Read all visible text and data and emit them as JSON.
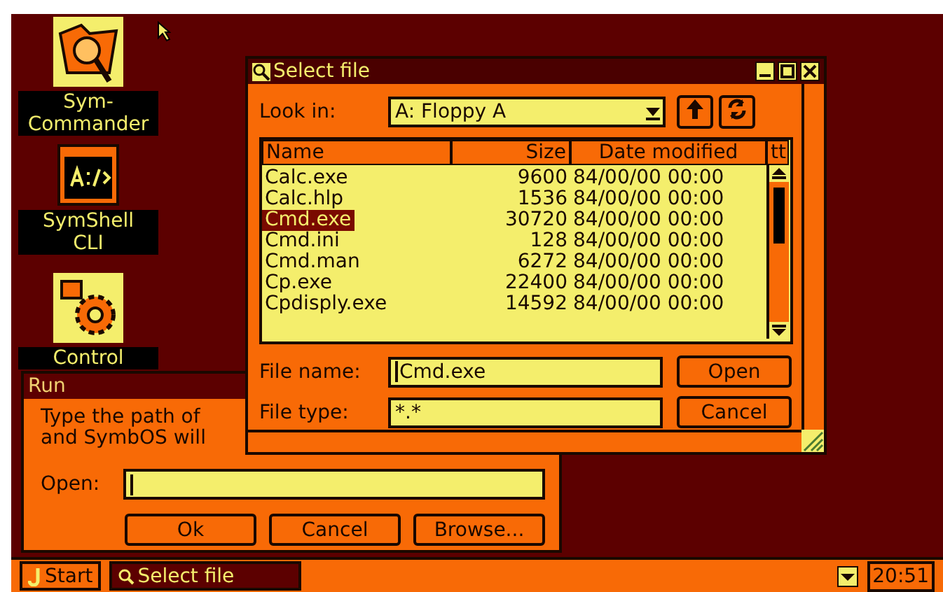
{
  "desktop_icons": [
    {
      "kind": "commander",
      "lines": [
        "Sym-",
        "Commander"
      ]
    },
    {
      "kind": "shell",
      "lines": [
        "SymShell",
        "CLI"
      ]
    },
    {
      "kind": "control",
      "lines": [
        "Control"
      ]
    }
  ],
  "run_window": {
    "title": "Run",
    "active": false,
    "message_lines": [
      "Type the path of",
      "and SymbOS will"
    ],
    "open_label": "Open:",
    "buttons": [
      "Ok",
      "Cancel",
      "Browse..."
    ]
  },
  "file_dialog": {
    "title": "Select file",
    "active": true,
    "look_in_label": "Look in:",
    "look_in_value": "A: Floppy A",
    "columns": [
      {
        "label": "Name"
      },
      {
        "label": "Size"
      },
      {
        "label": "Date modified"
      },
      {
        "label": "tt"
      }
    ],
    "rows": [
      {
        "name": "Calc.exe",
        "size": "9600",
        "date": "84/00/00 00:00",
        "selected": false
      },
      {
        "name": "Calc.hlp",
        "size": "1536",
        "date": "84/00/00 00:00",
        "selected": false
      },
      {
        "name": "Cmd.exe",
        "size": "30720",
        "date": "84/00/00 00:00",
        "selected": true
      },
      {
        "name": "Cmd.ini",
        "size": "128",
        "date": "84/00/00 00:00",
        "selected": false
      },
      {
        "name": "Cmd.man",
        "size": "6272",
        "date": "84/00/00 00:00",
        "selected": false
      },
      {
        "name": "Cp.exe",
        "size": "22400",
        "date": "84/00/00 00:00",
        "selected": false
      },
      {
        "name": "Cpdisply.exe",
        "size": "14592",
        "date": "84/00/00 00:00",
        "selected": false
      }
    ],
    "file_name_label": "File name:",
    "file_name_value": "Cmd.exe",
    "file_type_label": "File type:",
    "file_type_value": "*.*",
    "buttons": [
      "Open",
      "Cancel"
    ]
  },
  "taskbar": {
    "start": "Start",
    "tasks": [
      {
        "label": "Select file",
        "selected": true
      }
    ],
    "clock": "20:51"
  }
}
